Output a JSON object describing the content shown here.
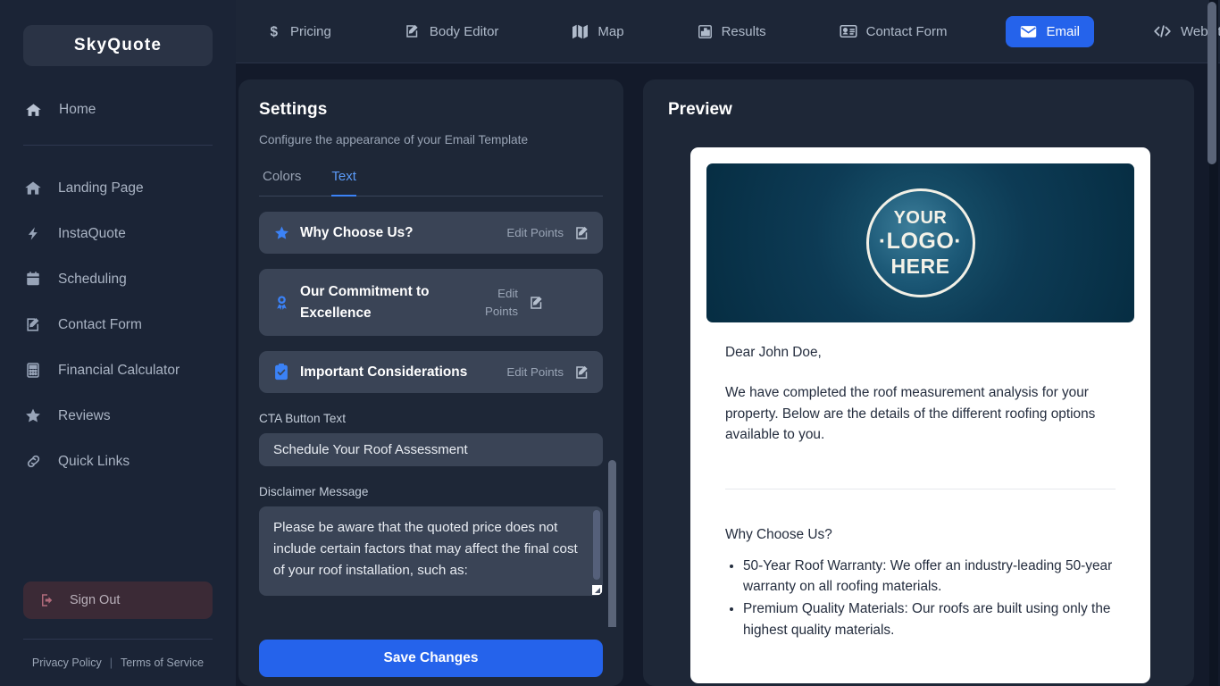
{
  "sidebar": {
    "brand": "SkyQuote",
    "home": {
      "label": "Home",
      "icon": "home-icon"
    },
    "items": [
      {
        "label": "Landing Page",
        "icon": "home-icon"
      },
      {
        "label": "InstaQuote",
        "icon": "bolt-icon"
      },
      {
        "label": "Scheduling",
        "icon": "calendar-icon"
      },
      {
        "label": "Contact Form",
        "icon": "edit-square-icon"
      },
      {
        "label": "Financial Calculator",
        "icon": "calculator-icon"
      },
      {
        "label": "Reviews",
        "icon": "star-icon"
      },
      {
        "label": "Quick Links",
        "icon": "link-icon"
      }
    ],
    "sign_out": {
      "label": "Sign Out",
      "icon": "sign-out-icon"
    },
    "footer": {
      "privacy": "Privacy Policy",
      "separator": "|",
      "terms": "Terms of Service"
    }
  },
  "topbar": {
    "items": [
      {
        "label": "Pricing",
        "icon": "dollar-icon",
        "active": false
      },
      {
        "label": "Body Editor",
        "icon": "edit-square-icon",
        "active": false
      },
      {
        "label": "Map",
        "icon": "map-icon",
        "active": false
      },
      {
        "label": "Results",
        "icon": "chart-bar-icon",
        "active": false
      },
      {
        "label": "Contact Form",
        "icon": "id-card-icon",
        "active": false
      },
      {
        "label": "Email",
        "icon": "envelope-icon",
        "active": true
      },
      {
        "label": "Website Integ",
        "icon": "code-icon",
        "active": false
      }
    ]
  },
  "settings": {
    "title": "Settings",
    "subtitle": "Configure the appearance of your Email Template",
    "tabs": [
      {
        "label": "Colors",
        "active": false
      },
      {
        "label": "Text",
        "active": true
      }
    ],
    "sections": [
      {
        "label": "Why Choose Us?",
        "edit_label": "Edit Points",
        "icon": "star-icon"
      },
      {
        "label": "Our Commitment to Excellence",
        "edit_label": "Edit Points",
        "icon": "award-icon"
      },
      {
        "label": "Important Considerations",
        "edit_label": "Edit Points",
        "icon": "clipboard-check-icon"
      }
    ],
    "cta_field": {
      "label": "CTA Button Text",
      "value": "Schedule Your Roof Assessment"
    },
    "disclaimer_field": {
      "label": "Disclaimer Message",
      "value": "Please be aware that the quoted price does not include certain factors that may affect the final cost of your roof installation, such as:"
    },
    "save_label": "Save Changes"
  },
  "preview": {
    "title": "Preview",
    "logo": {
      "line1": "YOUR",
      "line2": "·LOGO·",
      "line3": "HERE"
    },
    "greeting": "Dear John Doe,",
    "intro": "We have completed the roof measurement analysis for your property. Below are the details of the different roofing options available to you.",
    "section_heading": "Why Choose Us?",
    "bullets": [
      "50-Year Roof Warranty: We offer an industry-leading 50-year warranty on all roofing materials.",
      "Premium Quality Materials: Our roofs are built using only the highest quality materials."
    ]
  },
  "colors": {
    "page_bg": "#131a2a",
    "panel_bg": "#1e2737",
    "sidebar_bg": "#1b2436",
    "accent_blue": "#2563eb",
    "tab_active": "#5b9bf8",
    "card_bg": "#3a4456",
    "email_header_bg": "#0d3b55"
  }
}
